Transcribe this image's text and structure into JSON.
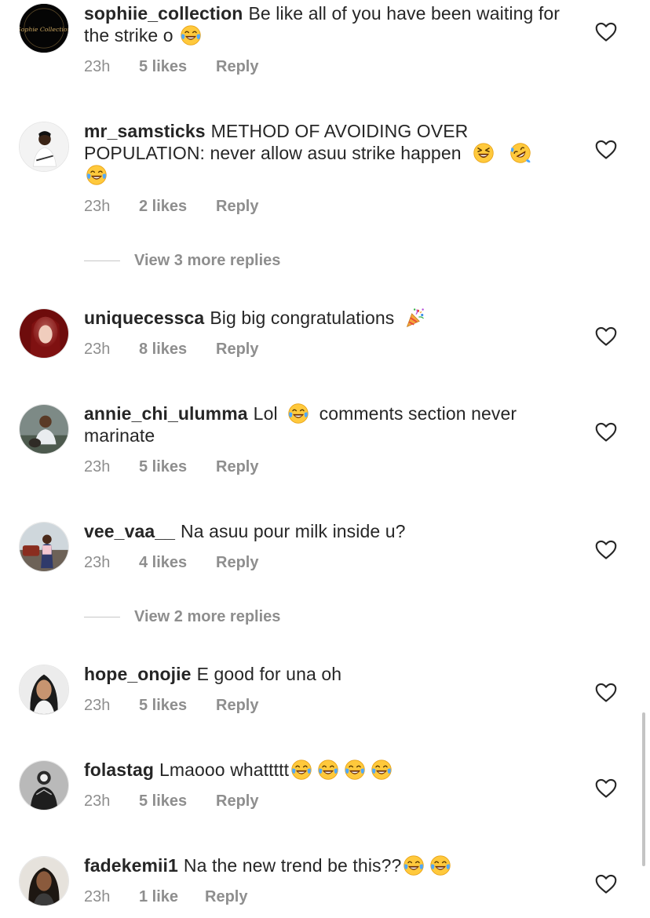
{
  "comments": [
    {
      "username": "sophiie_collection",
      "text": "Be like all of you have been waiting for the strike o",
      "emojis": [
        "joy"
      ],
      "time": "23h",
      "likes": "5 likes",
      "reply": "Reply",
      "avatar_text": "Sophie Collection"
    },
    {
      "username": "mr_samsticks",
      "text": "METHOD OF AVOIDING OVER POPULATION: never allow asuu strike happen",
      "emojis": [
        "laughing",
        "rofl",
        "joy"
      ],
      "time": "23h",
      "likes": "2 likes",
      "reply": "Reply"
    },
    {
      "username": "uniquecessca",
      "text": "Big big congratulations",
      "emojis": [
        "party-popper"
      ],
      "time": "23h",
      "likes": "8 likes",
      "reply": "Reply"
    },
    {
      "username": "annie_chi_ulumma",
      "text_before": "Lol",
      "emojis": [
        "joy"
      ],
      "text_after": "comments section never marinate",
      "time": "23h",
      "likes": "5 likes",
      "reply": "Reply"
    },
    {
      "username": "vee_vaa__",
      "text": "Na asuu pour milk inside u?",
      "time": "23h",
      "likes": "4 likes",
      "reply": "Reply"
    },
    {
      "username": "hope_onojie",
      "text": "E good for una oh",
      "time": "23h",
      "likes": "5 likes",
      "reply": "Reply"
    },
    {
      "username": "folastag",
      "text": "Lmaooo whattttt",
      "emojis": [
        "joy",
        "joy",
        "joy",
        "joy"
      ],
      "time": "23h",
      "likes": "5 likes",
      "reply": "Reply"
    },
    {
      "username": "fadekemii1",
      "text": "Na the new trend be this??",
      "emojis": [
        "joy",
        "joy"
      ],
      "time": "23h",
      "likes": "1 like",
      "reply": "Reply"
    }
  ],
  "view_replies": [
    {
      "label": "View 3 more replies"
    },
    {
      "label": "View 2 more replies"
    }
  ],
  "icons": {
    "like": "heart-outline-icon"
  },
  "colors": {
    "text": "#262626",
    "meta": "#8e8e8e",
    "divider": "#c7c7c7"
  }
}
